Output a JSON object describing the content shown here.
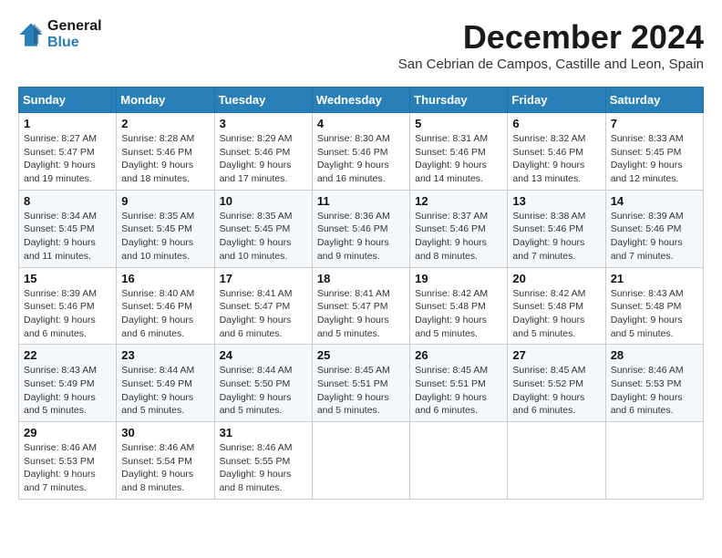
{
  "header": {
    "logo_line1": "General",
    "logo_line2": "Blue",
    "title": "December 2024",
    "subtitle": "San Cebrian de Campos, Castille and Leon, Spain"
  },
  "weekdays": [
    "Sunday",
    "Monday",
    "Tuesday",
    "Wednesday",
    "Thursday",
    "Friday",
    "Saturday"
  ],
  "weeks": [
    [
      {
        "day": "1",
        "sunrise": "8:27 AM",
        "sunset": "5:47 PM",
        "daylight": "9 hours and 19 minutes."
      },
      {
        "day": "2",
        "sunrise": "8:28 AM",
        "sunset": "5:46 PM",
        "daylight": "9 hours and 18 minutes."
      },
      {
        "day": "3",
        "sunrise": "8:29 AM",
        "sunset": "5:46 PM",
        "daylight": "9 hours and 17 minutes."
      },
      {
        "day": "4",
        "sunrise": "8:30 AM",
        "sunset": "5:46 PM",
        "daylight": "9 hours and 16 minutes."
      },
      {
        "day": "5",
        "sunrise": "8:31 AM",
        "sunset": "5:46 PM",
        "daylight": "9 hours and 14 minutes."
      },
      {
        "day": "6",
        "sunrise": "8:32 AM",
        "sunset": "5:46 PM",
        "daylight": "9 hours and 13 minutes."
      },
      {
        "day": "7",
        "sunrise": "8:33 AM",
        "sunset": "5:45 PM",
        "daylight": "9 hours and 12 minutes."
      }
    ],
    [
      {
        "day": "8",
        "sunrise": "8:34 AM",
        "sunset": "5:45 PM",
        "daylight": "9 hours and 11 minutes."
      },
      {
        "day": "9",
        "sunrise": "8:35 AM",
        "sunset": "5:45 PM",
        "daylight": "9 hours and 10 minutes."
      },
      {
        "day": "10",
        "sunrise": "8:35 AM",
        "sunset": "5:45 PM",
        "daylight": "9 hours and 10 minutes."
      },
      {
        "day": "11",
        "sunrise": "8:36 AM",
        "sunset": "5:46 PM",
        "daylight": "9 hours and 9 minutes."
      },
      {
        "day": "12",
        "sunrise": "8:37 AM",
        "sunset": "5:46 PM",
        "daylight": "9 hours and 8 minutes."
      },
      {
        "day": "13",
        "sunrise": "8:38 AM",
        "sunset": "5:46 PM",
        "daylight": "9 hours and 7 minutes."
      },
      {
        "day": "14",
        "sunrise": "8:39 AM",
        "sunset": "5:46 PM",
        "daylight": "9 hours and 7 minutes."
      }
    ],
    [
      {
        "day": "15",
        "sunrise": "8:39 AM",
        "sunset": "5:46 PM",
        "daylight": "9 hours and 6 minutes."
      },
      {
        "day": "16",
        "sunrise": "8:40 AM",
        "sunset": "5:46 PM",
        "daylight": "9 hours and 6 minutes."
      },
      {
        "day": "17",
        "sunrise": "8:41 AM",
        "sunset": "5:47 PM",
        "daylight": "9 hours and 6 minutes."
      },
      {
        "day": "18",
        "sunrise": "8:41 AM",
        "sunset": "5:47 PM",
        "daylight": "9 hours and 5 minutes."
      },
      {
        "day": "19",
        "sunrise": "8:42 AM",
        "sunset": "5:48 PM",
        "daylight": "9 hours and 5 minutes."
      },
      {
        "day": "20",
        "sunrise": "8:42 AM",
        "sunset": "5:48 PM",
        "daylight": "9 hours and 5 minutes."
      },
      {
        "day": "21",
        "sunrise": "8:43 AM",
        "sunset": "5:48 PM",
        "daylight": "9 hours and 5 minutes."
      }
    ],
    [
      {
        "day": "22",
        "sunrise": "8:43 AM",
        "sunset": "5:49 PM",
        "daylight": "9 hours and 5 minutes."
      },
      {
        "day": "23",
        "sunrise": "8:44 AM",
        "sunset": "5:49 PM",
        "daylight": "9 hours and 5 minutes."
      },
      {
        "day": "24",
        "sunrise": "8:44 AM",
        "sunset": "5:50 PM",
        "daylight": "9 hours and 5 minutes."
      },
      {
        "day": "25",
        "sunrise": "8:45 AM",
        "sunset": "5:51 PM",
        "daylight": "9 hours and 5 minutes."
      },
      {
        "day": "26",
        "sunrise": "8:45 AM",
        "sunset": "5:51 PM",
        "daylight": "9 hours and 6 minutes."
      },
      {
        "day": "27",
        "sunrise": "8:45 AM",
        "sunset": "5:52 PM",
        "daylight": "9 hours and 6 minutes."
      },
      {
        "day": "28",
        "sunrise": "8:46 AM",
        "sunset": "5:53 PM",
        "daylight": "9 hours and 6 minutes."
      }
    ],
    [
      {
        "day": "29",
        "sunrise": "8:46 AM",
        "sunset": "5:53 PM",
        "daylight": "9 hours and 7 minutes."
      },
      {
        "day": "30",
        "sunrise": "8:46 AM",
        "sunset": "5:54 PM",
        "daylight": "9 hours and 8 minutes."
      },
      {
        "day": "31",
        "sunrise": "8:46 AM",
        "sunset": "5:55 PM",
        "daylight": "9 hours and 8 minutes."
      },
      null,
      null,
      null,
      null
    ]
  ]
}
